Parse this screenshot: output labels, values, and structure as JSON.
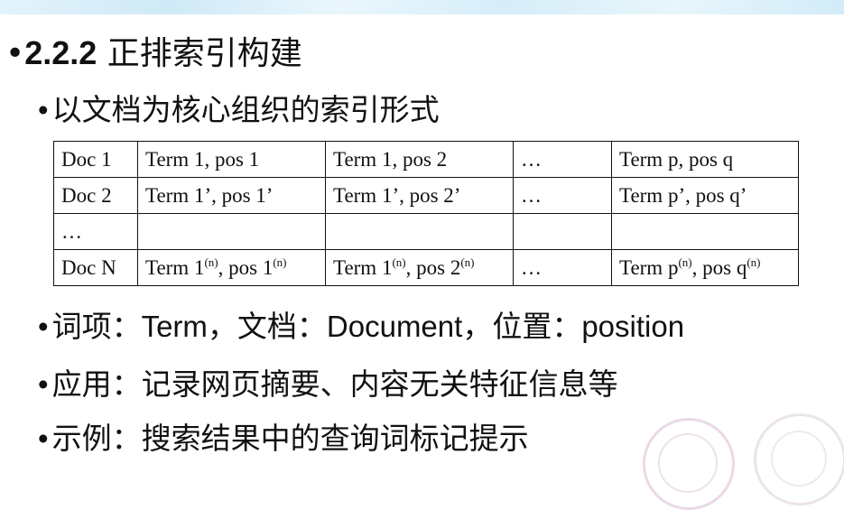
{
  "heading": {
    "number": "2.2.2",
    "title": "正排索引构建"
  },
  "bullet_marker": "•",
  "bullets": {
    "subtitle": "以文档为核心组织的索引形式",
    "terms_prefix": "词项：",
    "terms_term": "Term",
    "terms_sep1": "，文档：",
    "terms_document": "Document",
    "terms_sep2": "，位置：",
    "terms_position": "position",
    "application": "应用：记录网页摘要、内容无关特征信息等",
    "example": "示例：搜索结果中的查询词标记提示"
  },
  "table": {
    "rows": [
      [
        "Doc 1",
        "Term 1, pos 1",
        "Term 1, pos 2",
        "…",
        "Term p, pos q"
      ],
      [
        "Doc 2",
        "Term 1’, pos 1’",
        "Term 1’, pos 2’",
        "…",
        "Term p’, pos q’"
      ],
      [
        "…",
        "",
        "",
        "",
        ""
      ]
    ],
    "last_row": {
      "doc": "Doc N",
      "c1": {
        "a": "Term 1",
        "a_sup": "(n)",
        "b": ", pos 1",
        "b_sup": "(n)"
      },
      "c2": {
        "a": "Term 1",
        "a_sup": "(n)",
        "b": ", pos 2",
        "b_sup": "(n)"
      },
      "c3": "…",
      "c4": {
        "a": "Term p",
        "a_sup": "(n)",
        "b": ", pos q",
        "b_sup": "(n)"
      }
    }
  },
  "colors": {
    "top_band": "#cfeaf7",
    "seal": "#ead8e6",
    "text": "#111111"
  }
}
